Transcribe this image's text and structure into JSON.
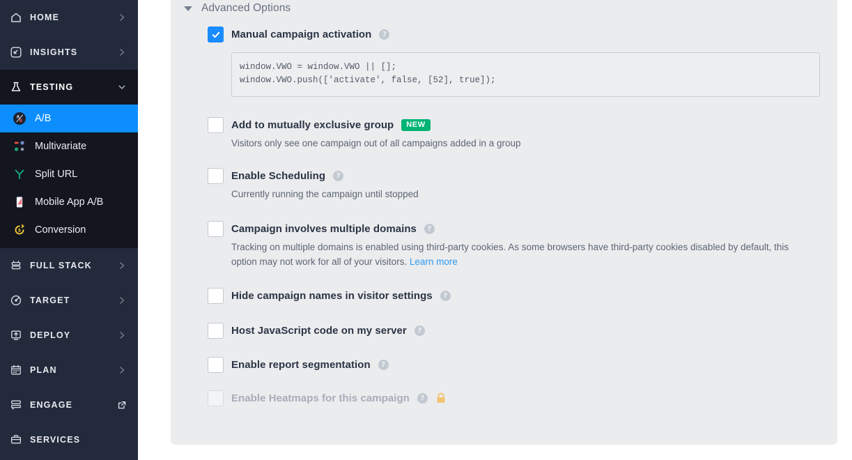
{
  "sidebar": {
    "top_items": [
      {
        "label": "HOME",
        "icon": "home-icon",
        "arrow": "chevron-right-icon"
      },
      {
        "label": "INSIGHTS",
        "icon": "insights-cursor-icon",
        "arrow": "chevron-right-icon"
      }
    ],
    "testing": {
      "label": "TESTING",
      "icon": "flask-icon",
      "arrow": "chevron-down-icon",
      "items": [
        {
          "label": "A/B",
          "icon": "ab-circle-icon",
          "active": true
        },
        {
          "label": "Multivariate",
          "icon": "multivariate-squares-icon",
          "active": false
        },
        {
          "label": "Split URL",
          "icon": "split-url-icon",
          "active": false
        },
        {
          "label": "Mobile App A/B",
          "icon": "mobile-phone-icon",
          "active": false
        },
        {
          "label": "Conversion",
          "icon": "conversion-dollar-icon",
          "active": false
        }
      ]
    },
    "lower_items": [
      {
        "label": "FULL STACK",
        "icon": "stack-icon",
        "arrow": "chevron-right-icon"
      },
      {
        "label": "TARGET",
        "icon": "target-icon",
        "arrow": "chevron-right-icon"
      },
      {
        "label": "DEPLOY",
        "icon": "deploy-icon",
        "arrow": "chevron-right-icon"
      },
      {
        "label": "PLAN",
        "icon": "calendar-icon",
        "arrow": "chevron-right-icon"
      },
      {
        "label": "ENGAGE",
        "icon": "engage-icon",
        "arrow": "external-link-icon"
      },
      {
        "label": "SERVICES",
        "icon": "briefcase-icon",
        "arrow": "none"
      }
    ]
  },
  "panel": {
    "header": {
      "title": "Advanced Options",
      "caret": "caret-down-icon"
    },
    "options": [
      {
        "id": "manual-campaign-activation",
        "label": "Manual campaign activation",
        "checked": true,
        "disabled": false,
        "help_icon": "help-circle-icon",
        "code": "window.VWO = window.VWO || [];\nwindow.VWO.push(['activate', false, [52], true]);"
      },
      {
        "id": "mutually-exclusive-group",
        "label": "Add to mutually exclusive group",
        "checked": false,
        "disabled": false,
        "badge": "NEW",
        "description": "Visitors only see one campaign out of all campaigns added in a group"
      },
      {
        "id": "enable-scheduling",
        "label": "Enable Scheduling",
        "checked": false,
        "disabled": false,
        "help_icon": "help-circle-icon",
        "description": "Currently running the campaign until stopped"
      },
      {
        "id": "multiple-domains",
        "label": "Campaign involves multiple domains",
        "checked": false,
        "disabled": false,
        "help_icon": "help-circle-icon",
        "description": "Tracking on multiple domains is enabled using third-party cookies. As some browsers have third-party cookies disabled by default, this option may not work for all of your visitors. ",
        "link_text": "Learn more"
      },
      {
        "id": "hide-campaign-names",
        "label": "Hide campaign names in visitor settings",
        "checked": false,
        "disabled": false,
        "help_icon": "help-circle-icon"
      },
      {
        "id": "host-javascript",
        "label": "Host JavaScript code on my server",
        "checked": false,
        "disabled": false,
        "help_icon": "help-circle-icon"
      },
      {
        "id": "report-segmentation",
        "label": "Enable report segmentation",
        "checked": false,
        "disabled": false,
        "help_icon": "help-circle-icon"
      },
      {
        "id": "enable-heatmaps",
        "label": "Enable Heatmaps for this campaign",
        "checked": false,
        "disabled": true,
        "help_icon": "help-circle-icon",
        "lock_icon": "lock-icon"
      }
    ]
  },
  "colors": {
    "sidebar_bg": "#232a3b",
    "sidebar_testing_bg": "#13161f",
    "active_blue": "#0d8eff",
    "panel_bg": "#ebecee",
    "checkbox_blue": "#1a8cff",
    "badge_green": "#00b473",
    "link_blue": "#2e9bf0",
    "lock_amber": "#f2c470"
  }
}
